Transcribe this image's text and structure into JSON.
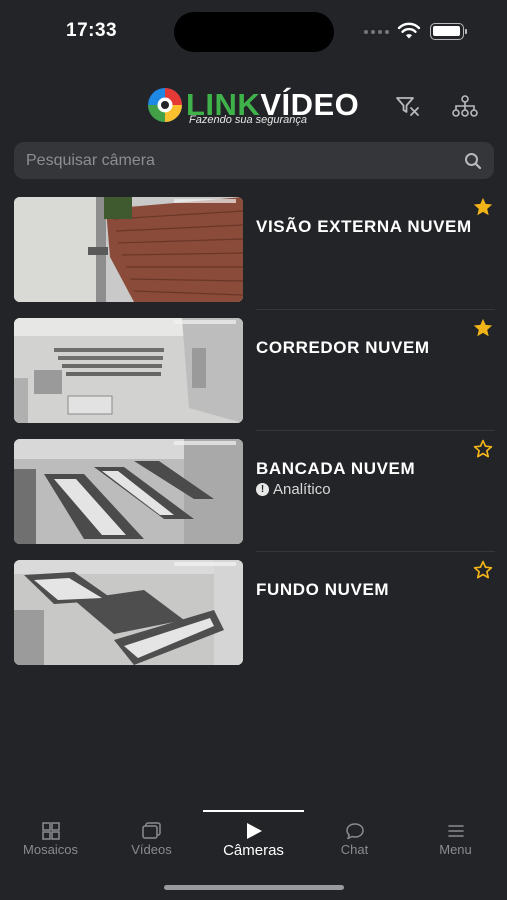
{
  "status": {
    "time": "17:33"
  },
  "header": {
    "logo": {
      "link": "LINK",
      "video": "VÍDEO",
      "tagline": "Fazendo sua segurança"
    },
    "icons": [
      "filter-clear-icon",
      "hierarchy-icon"
    ]
  },
  "search": {
    "placeholder": "Pesquisar câmera",
    "value": ""
  },
  "cameras": [
    {
      "name": "VISÃO EXTERNA NUVEM",
      "subtitle": "",
      "favorite": true
    },
    {
      "name": "CORREDOR NUVEM",
      "subtitle": "",
      "favorite": true
    },
    {
      "name": "BANCADA NUVEM",
      "subtitle": "Analítico",
      "favorite": false
    },
    {
      "name": "FUNDO NUVEM",
      "subtitle": "",
      "favorite": false
    }
  ],
  "tabs": [
    {
      "label": "Mosaicos",
      "icon": "grid-icon",
      "active": false
    },
    {
      "label": "Vídeos",
      "icon": "videos-icon",
      "active": false
    },
    {
      "label": "Câmeras",
      "icon": "play-icon",
      "active": true
    },
    {
      "label": "Chat",
      "icon": "chat-icon",
      "active": false
    },
    {
      "label": "Menu",
      "icon": "menu-icon",
      "active": false
    }
  ],
  "colors": {
    "background": "#232427",
    "star": "#f2b418",
    "logo_green": "#3fb24a"
  }
}
